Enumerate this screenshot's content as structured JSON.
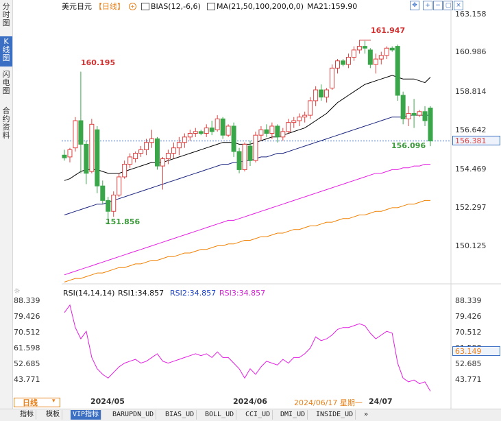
{
  "sidebar": {
    "tabs": [
      {
        "label": "分\n时\n图",
        "active": false
      },
      {
        "label": "K\n线\n图",
        "active": true
      },
      {
        "label": "闪\n电\n图",
        "active": false
      },
      {
        "label": "合\n约\n资\n料",
        "active": false
      }
    ]
  },
  "header": {
    "symbol": "美元日元",
    "period": "【日线】",
    "bias_label": "BIAS(12,-6,6)",
    "ma_label": "MA(21,50,100,200,0,0)",
    "ma21_value": "MA21:159.90",
    "icons": [
      "move-icon",
      "zoom-in-icon",
      "zoom-out-icon",
      "restore-icon",
      "close-icon"
    ]
  },
  "price_axis": {
    "ticks": [
      "163.158",
      "160.986",
      "158.814",
      "156.642",
      "154.469",
      "152.297",
      "150.125"
    ],
    "current_price_tag": "156.381",
    "annotations": [
      "160.195",
      "161.947",
      "151.856",
      "156.096"
    ]
  },
  "rsi_header": {
    "label": "RSI(14,14,14)",
    "rsi1": "RSI1:34.857",
    "rsi2": "RSI2:34.857",
    "rsi3": "RSI3:34.857"
  },
  "rsi_axis": {
    "ticks": [
      "88.339",
      "79.426",
      "70.512",
      "61.598",
      "52.685",
      "43.771"
    ],
    "current_tag": "63.149"
  },
  "time_axis": {
    "period_label": "日线",
    "labels": [
      "2024/05",
      "2024/06",
      "2024/06/17 星期一",
      "24/07"
    ]
  },
  "bottom_tabs": [
    "指标",
    "模板",
    "VIP指标",
    "BARUPDN_UD",
    "BIAS_UD",
    "BOLL_UD",
    "CCI_UD",
    "DMI_UD",
    "INSIDE_UD",
    "»"
  ],
  "colors": {
    "up": "#e04040",
    "down": "#3aa64a",
    "ma21": "#000000",
    "ma50": "#1a237e",
    "ma100": "#e21ee0",
    "ma200": "#f08000",
    "rsi": "#e21ee0",
    "accent": "#3a6fc4"
  },
  "chart_data": [
    {
      "type": "candlestick",
      "title": "美元日元【日线】",
      "ylim": [
        148.5,
        163.4
      ],
      "x": [
        "2024/05",
        "2024/06",
        "24/07"
      ],
      "candles": [
        {
          "o": 155.6,
          "h": 155.9,
          "l": 155.3,
          "c": 155.45
        },
        {
          "o": 155.5,
          "h": 156.0,
          "l": 155.2,
          "c": 155.9
        },
        {
          "o": 156.0,
          "h": 157.7,
          "l": 155.8,
          "c": 157.5
        },
        {
          "o": 157.5,
          "h": 160.2,
          "l": 154.6,
          "c": 156.2
        },
        {
          "o": 156.2,
          "h": 156.4,
          "l": 154.0,
          "c": 154.6
        },
        {
          "o": 154.7,
          "h": 157.6,
          "l": 154.6,
          "c": 157.3
        },
        {
          "o": 157.0,
          "h": 157.2,
          "l": 153.5,
          "c": 153.9
        },
        {
          "o": 153.9,
          "h": 154.2,
          "l": 152.9,
          "c": 153.1
        },
        {
          "o": 153.1,
          "h": 153.3,
          "l": 151.86,
          "c": 152.5
        },
        {
          "o": 152.5,
          "h": 153.6,
          "l": 152.2,
          "c": 153.4
        },
        {
          "o": 153.4,
          "h": 154.6,
          "l": 153.3,
          "c": 154.4
        },
        {
          "o": 154.4,
          "h": 155.3,
          "l": 154.3,
          "c": 155.1
        },
        {
          "o": 155.1,
          "h": 155.7,
          "l": 154.9,
          "c": 155.5
        },
        {
          "o": 155.4,
          "h": 155.8,
          "l": 155.2,
          "c": 155.7
        },
        {
          "o": 155.7,
          "h": 156.1,
          "l": 155.5,
          "c": 155.9
        },
        {
          "o": 155.9,
          "h": 156.5,
          "l": 155.6,
          "c": 156.3
        },
        {
          "o": 156.3,
          "h": 157.0,
          "l": 156.0,
          "c": 156.5
        },
        {
          "o": 156.5,
          "h": 156.6,
          "l": 154.8,
          "c": 155.0
        },
        {
          "o": 155.0,
          "h": 155.5,
          "l": 153.7,
          "c": 155.4
        },
        {
          "o": 155.4,
          "h": 155.9,
          "l": 155.1,
          "c": 155.7
        },
        {
          "o": 155.7,
          "h": 156.3,
          "l": 155.4,
          "c": 156.0
        },
        {
          "o": 156.0,
          "h": 156.6,
          "l": 155.6,
          "c": 156.3
        },
        {
          "o": 156.3,
          "h": 156.8,
          "l": 156.0,
          "c": 156.6
        },
        {
          "o": 156.6,
          "h": 157.0,
          "l": 156.4,
          "c": 156.8
        },
        {
          "o": 156.8,
          "h": 157.1,
          "l": 156.6,
          "c": 156.9
        },
        {
          "o": 156.9,
          "h": 157.0,
          "l": 156.7,
          "c": 156.8
        },
        {
          "o": 156.8,
          "h": 157.3,
          "l": 156.6,
          "c": 157.1
        },
        {
          "o": 157.1,
          "h": 157.5,
          "l": 156.7,
          "c": 156.9
        },
        {
          "o": 157.0,
          "h": 157.8,
          "l": 156.9,
          "c": 157.6
        },
        {
          "o": 157.6,
          "h": 157.7,
          "l": 156.5,
          "c": 156.7
        },
        {
          "o": 156.7,
          "h": 157.3,
          "l": 156.6,
          "c": 157.2
        },
        {
          "o": 157.2,
          "h": 157.4,
          "l": 155.5,
          "c": 155.8
        },
        {
          "o": 155.8,
          "h": 156.0,
          "l": 154.6,
          "c": 154.8
        },
        {
          "o": 154.8,
          "h": 156.3,
          "l": 154.7,
          "c": 156.2
        },
        {
          "o": 156.1,
          "h": 156.4,
          "l": 155.0,
          "c": 155.3
        },
        {
          "o": 155.3,
          "h": 156.9,
          "l": 155.2,
          "c": 156.7
        },
        {
          "o": 156.7,
          "h": 157.2,
          "l": 156.4,
          "c": 157.0
        },
        {
          "o": 157.0,
          "h": 157.3,
          "l": 156.6,
          "c": 156.8
        },
        {
          "o": 156.8,
          "h": 157.4,
          "l": 156.5,
          "c": 157.2
        },
        {
          "o": 157.2,
          "h": 157.3,
          "l": 156.3,
          "c": 156.6
        },
        {
          "o": 156.6,
          "h": 157.1,
          "l": 156.4,
          "c": 156.9
        },
        {
          "o": 156.9,
          "h": 157.6,
          "l": 156.8,
          "c": 157.4
        },
        {
          "o": 157.4,
          "h": 157.7,
          "l": 157.1,
          "c": 157.5
        },
        {
          "o": 157.5,
          "h": 157.9,
          "l": 157.2,
          "c": 157.7
        },
        {
          "o": 157.7,
          "h": 158.0,
          "l": 157.4,
          "c": 157.8
        },
        {
          "o": 157.8,
          "h": 158.8,
          "l": 157.6,
          "c": 158.6
        },
        {
          "o": 158.6,
          "h": 159.4,
          "l": 158.3,
          "c": 159.2
        },
        {
          "o": 159.2,
          "h": 159.5,
          "l": 158.6,
          "c": 158.8
        },
        {
          "o": 158.8,
          "h": 159.3,
          "l": 158.5,
          "c": 159.2
        },
        {
          "o": 159.3,
          "h": 160.6,
          "l": 159.2,
          "c": 160.4
        },
        {
          "o": 160.4,
          "h": 160.9,
          "l": 160.1,
          "c": 160.8
        },
        {
          "o": 160.8,
          "h": 160.9,
          "l": 160.5,
          "c": 160.6
        },
        {
          "o": 160.6,
          "h": 161.2,
          "l": 160.4,
          "c": 161.0
        },
        {
          "o": 161.0,
          "h": 161.6,
          "l": 160.8,
          "c": 161.4
        },
        {
          "o": 161.4,
          "h": 161.947,
          "l": 161.2,
          "c": 161.6
        },
        {
          "o": 161.6,
          "h": 161.9,
          "l": 161.2,
          "c": 161.5
        },
        {
          "o": 161.4,
          "h": 161.5,
          "l": 160.4,
          "c": 160.6
        },
        {
          "o": 160.6,
          "h": 161.2,
          "l": 160.1,
          "c": 160.9
        },
        {
          "o": 160.9,
          "h": 161.3,
          "l": 160.6,
          "c": 161.1
        },
        {
          "o": 161.1,
          "h": 161.6,
          "l": 160.9,
          "c": 161.5
        },
        {
          "o": 161.5,
          "h": 161.6,
          "l": 161.3,
          "c": 161.4
        },
        {
          "o": 161.6,
          "h": 161.7,
          "l": 158.6,
          "c": 158.9
        },
        {
          "o": 158.9,
          "h": 159.1,
          "l": 157.3,
          "c": 157.6
        },
        {
          "o": 157.6,
          "h": 158.3,
          "l": 157.2,
          "c": 157.9
        },
        {
          "o": 157.9,
          "h": 158.7,
          "l": 157.1,
          "c": 157.8
        },
        {
          "o": 157.8,
          "h": 158.1,
          "l": 157.7,
          "c": 158.0
        },
        {
          "o": 158.0,
          "h": 158.3,
          "l": 157.2,
          "c": 157.5
        },
        {
          "o": 158.2,
          "h": 158.3,
          "l": 156.096,
          "c": 156.381
        }
      ],
      "series": [
        {
          "name": "MA21",
          "values": [
            154.2,
            154.3,
            154.5,
            154.7,
            154.8,
            154.8,
            154.8,
            154.7,
            154.6,
            154.6,
            154.6,
            154.7,
            154.8,
            154.9,
            155.0,
            155.1,
            155.2,
            155.2,
            155.2,
            155.3,
            155.4,
            155.5,
            155.6,
            155.7,
            155.8,
            155.9,
            156.0,
            156.1,
            156.2,
            156.3,
            156.3,
            156.3,
            156.2,
            156.2,
            156.2,
            156.3,
            156.4,
            156.5,
            156.6,
            156.6,
            156.7,
            156.8,
            156.9,
            157.0,
            157.1,
            157.3,
            157.5,
            157.7,
            157.9,
            158.2,
            158.5,
            158.7,
            158.9,
            159.1,
            159.3,
            159.5,
            159.6,
            159.7,
            159.8,
            159.9,
            160.0,
            159.9,
            159.8,
            159.8,
            159.8,
            159.7,
            159.6,
            159.9
          ]
        },
        {
          "name": "MA50",
          "values": [
            152.3,
            152.4,
            152.5,
            152.6,
            152.7,
            152.8,
            152.9,
            152.9,
            153.0,
            153.1,
            153.2,
            153.3,
            153.4,
            153.5,
            153.6,
            153.7,
            153.8,
            153.9,
            154.0,
            154.1,
            154.2,
            154.3,
            154.4,
            154.5,
            154.6,
            154.7,
            154.8,
            154.9,
            155.0,
            155.1,
            155.1,
            155.2,
            155.2,
            155.3,
            155.3,
            155.4,
            155.5,
            155.5,
            155.6,
            155.7,
            155.7,
            155.8,
            155.9,
            156.0,
            156.1,
            156.2,
            156.3,
            156.4,
            156.5,
            156.6,
            156.7,
            156.8,
            156.9,
            157.0,
            157.1,
            157.2,
            157.3,
            157.4,
            157.5,
            157.6,
            157.7,
            157.7,
            157.7,
            157.8,
            157.8,
            157.8,
            157.8,
            157.8
          ]
        },
        {
          "name": "MA100",
          "values": [
            149.0,
            149.1,
            149.2,
            149.3,
            149.4,
            149.5,
            149.6,
            149.7,
            149.8,
            149.9,
            150.0,
            150.1,
            150.2,
            150.3,
            150.4,
            150.5,
            150.6,
            150.7,
            150.8,
            150.9,
            151.0,
            151.1,
            151.2,
            151.3,
            151.4,
            151.5,
            151.6,
            151.7,
            151.8,
            151.9,
            152.0,
            152.0,
            152.1,
            152.2,
            152.3,
            152.4,
            152.5,
            152.6,
            152.7,
            152.8,
            152.9,
            153.0,
            153.1,
            153.2,
            153.3,
            153.4,
            153.5,
            153.6,
            153.7,
            153.8,
            153.9,
            154.0,
            154.1,
            154.2,
            154.3,
            154.4,
            154.5,
            154.6,
            154.6,
            154.7,
            154.8,
            154.8,
            154.9,
            154.9,
            155.0,
            155.0,
            155.1,
            155.1
          ]
        },
        {
          "name": "MA200",
          "values": [
            148.6,
            148.7,
            148.8,
            148.8,
            148.9,
            149.0,
            149.1,
            149.1,
            149.2,
            149.3,
            149.4,
            149.4,
            149.5,
            149.6,
            149.6,
            149.7,
            149.8,
            149.8,
            149.9,
            150.0,
            150.0,
            150.1,
            150.2,
            150.2,
            150.3,
            150.4,
            150.4,
            150.5,
            150.6,
            150.6,
            150.7,
            150.7,
            150.8,
            150.9,
            150.9,
            151.0,
            151.1,
            151.1,
            151.2,
            151.3,
            151.3,
            151.4,
            151.5,
            151.5,
            151.6,
            151.7,
            151.7,
            151.8,
            151.9,
            151.9,
            152.0,
            152.1,
            152.1,
            152.2,
            152.3,
            152.3,
            152.4,
            152.5,
            152.5,
            152.6,
            152.7,
            152.7,
            152.8,
            152.9,
            152.9,
            153.0,
            153.1,
            153.1
          ]
        }
      ]
    },
    {
      "type": "line",
      "title": "RSI(14,14,14)",
      "ylim": [
        38,
        90
      ],
      "series": [
        {
          "name": "RSI1",
          "values": [
            82,
            86,
            74,
            68,
            72,
            58,
            52,
            49,
            47,
            50,
            53,
            55,
            56,
            57,
            55,
            56,
            58,
            60,
            56,
            55,
            56,
            57,
            58,
            59,
            60,
            59,
            60,
            58,
            61,
            58,
            58,
            55,
            52,
            47,
            52,
            49,
            53,
            56,
            55,
            54,
            57,
            55,
            58,
            58,
            60,
            63,
            69,
            67,
            68,
            70,
            73,
            74,
            74,
            75,
            76,
            75,
            71,
            68,
            70,
            72,
            71,
            55,
            47,
            45,
            46,
            44,
            45,
            40
          ]
        }
      ]
    }
  ]
}
